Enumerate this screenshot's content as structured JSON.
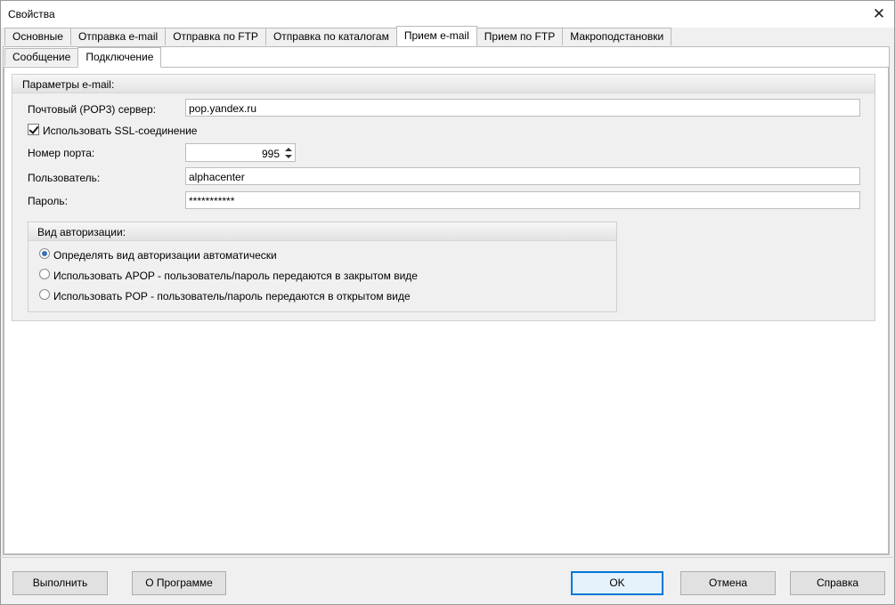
{
  "window": {
    "title": "Свойства"
  },
  "tabs": [
    "Основные",
    "Отправка e-mail",
    "Отправка по FTP",
    "Отправка по каталогам",
    "Прием e-mail",
    "Прием по FTP",
    "Макроподстановки"
  ],
  "subtabs": [
    "Сообщение",
    "Подключение"
  ],
  "email_params": {
    "group_title": "Параметры e-mail:",
    "server_label": "Почтовый (POP3) сервер:",
    "server_value": "pop.yandex.ru",
    "ssl_label": "Использовать SSL-соединение",
    "ssl_checked": true,
    "port_label": "Номер порта:",
    "port_value": "995",
    "user_label": "Пользователь:",
    "user_value": "alphacenter",
    "password_label": "Пароль:",
    "password_value": "***********"
  },
  "auth": {
    "title": "Вид авторизации:",
    "options": [
      "Определять вид авторизации автоматически",
      "Использовать APOP - пользователь/пароль передаются в закрытом виде",
      "Использовать POP - пользователь/пароль передаются в открытом виде"
    ],
    "selected_index": 0
  },
  "buttons": {
    "execute": "Выполнить",
    "about": "О Программе",
    "ok": "OK",
    "cancel": "Отмена",
    "help": "Справка"
  },
  "colors": {
    "radio_selected": "#3b6fb6",
    "default_button_border": "#0078d7"
  }
}
